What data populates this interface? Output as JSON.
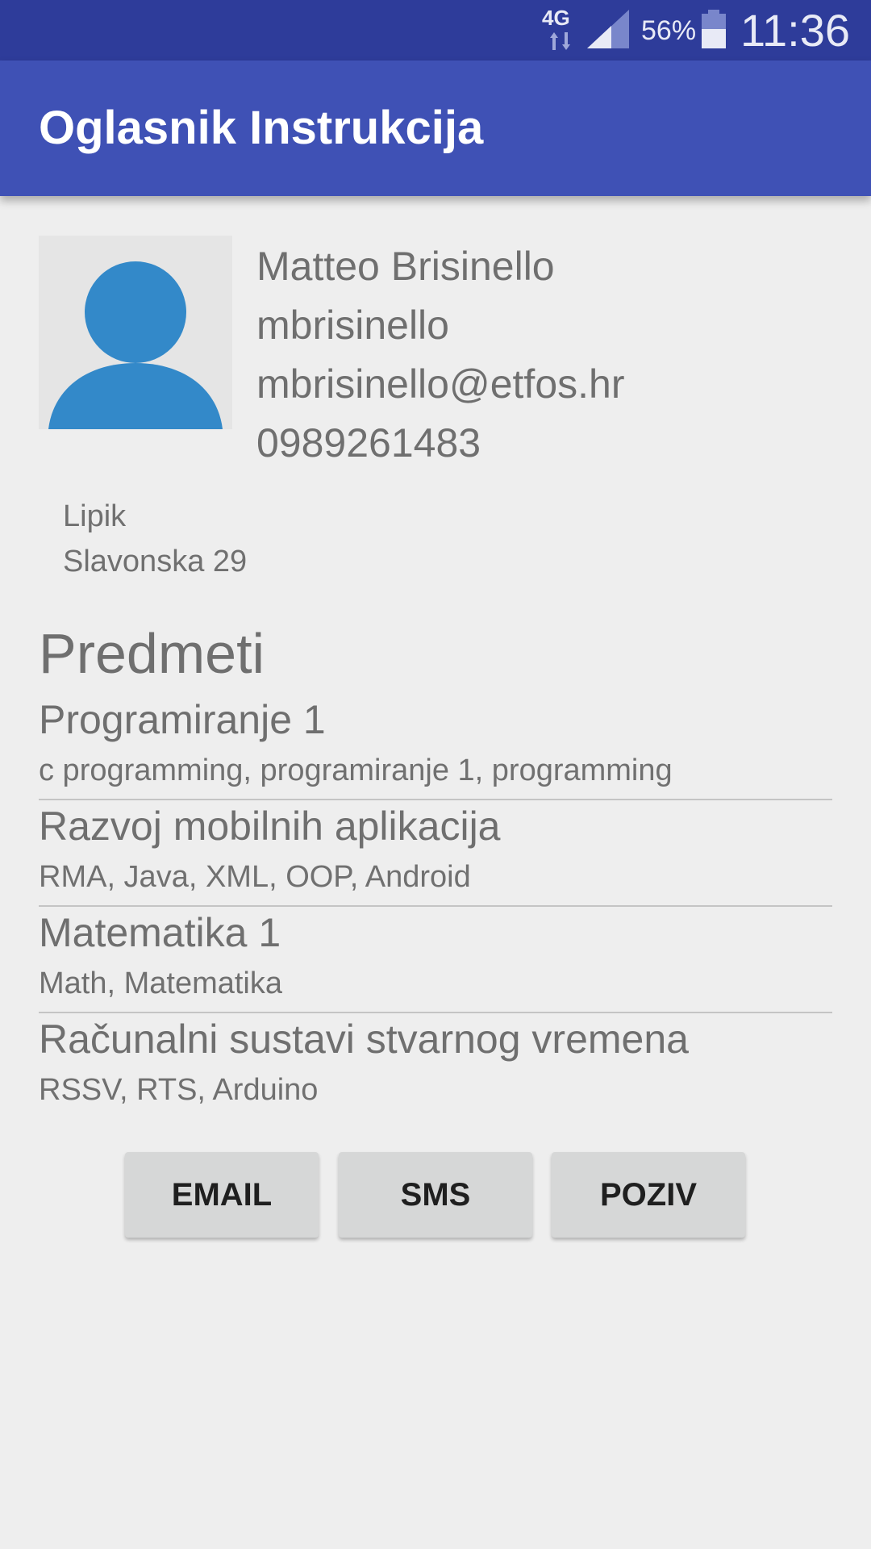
{
  "status_bar": {
    "network": "4G",
    "battery_percent": "56%",
    "time": "11:36",
    "icons": [
      "data-arrows-icon",
      "signal-icon",
      "battery-icon"
    ],
    "signal_level": 0.6,
    "battery_level": 0.56
  },
  "app_bar": {
    "title": "Oglasnik Instrukcija",
    "color": "#3f51b5"
  },
  "profile": {
    "avatar_icon": "person-avatar-icon",
    "avatar_color": "#3389c9",
    "name": "Matteo Brisinello",
    "username": "mbrisinello",
    "email": "mbrisinello@etfos.hr",
    "phone": "0989261483",
    "city": "Lipik",
    "street": "Slavonska 29"
  },
  "subjects_section": {
    "title": "Predmeti",
    "items": [
      {
        "name": "Programiranje 1",
        "tags": "c programming, programiranje 1, programming"
      },
      {
        "name": "Razvoj mobilnih aplikacija",
        "tags": "RMA, Java, XML, OOP, Android"
      },
      {
        "name": "Matematika 1",
        "tags": "Math, Matematika"
      },
      {
        "name": "Računalni sustavi stvarnog vremena",
        "tags": "RSSV, RTS, Arduino"
      }
    ]
  },
  "actions": {
    "email_label": "EMAIL",
    "sms_label": "SMS",
    "call_label": "POZIV"
  }
}
